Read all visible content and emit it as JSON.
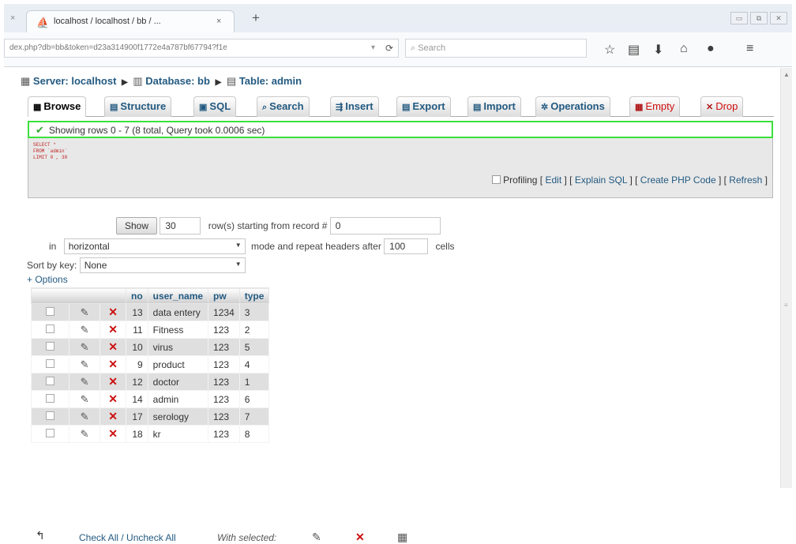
{
  "browser": {
    "tab_close_left": "×",
    "tab_title": "localhost / localhost / bb / ...",
    "tab_close": "×",
    "new_tab": "+",
    "url": "dex.php?db=bb&token=d23a314900f1772e4a787bf67794?f1e",
    "search_placeholder": "Search",
    "win_minimize": "▭",
    "win_restore": "⧉",
    "win_close": "✕"
  },
  "breadcrumb": {
    "server": "Server: localhost",
    "database": "Database: bb",
    "table": "Table: admin"
  },
  "tabs": [
    {
      "label": "Browse",
      "icon": "▦"
    },
    {
      "label": "Structure",
      "icon": "▤"
    },
    {
      "label": "SQL",
      "icon": "▣"
    },
    {
      "label": "Search",
      "icon": "⌕"
    },
    {
      "label": "Insert",
      "icon": "⇶"
    },
    {
      "label": "Export",
      "icon": "▤"
    },
    {
      "label": "Import",
      "icon": "▤"
    },
    {
      "label": "Operations",
      "icon": "✲"
    },
    {
      "label": "Empty",
      "icon": "▦"
    },
    {
      "label": "Drop",
      "icon": "✕"
    }
  ],
  "status": {
    "message": "Showing rows 0 - 7 (8 total, Query took 0.0006 sec)",
    "sql_query": "SELECT *\nFROM `admin`\nLIMIT 0 , 30"
  },
  "sql_links": {
    "profiling": "Profiling",
    "edit": "Edit",
    "explain": "Explain SQL",
    "create_php": "Create PHP Code",
    "refresh": "Refresh"
  },
  "nav_controls": {
    "show_button": "Show",
    "rows_value": "30",
    "rows_label": "row(s) starting from record #",
    "start_value": "0",
    "in_label": "in",
    "mode_value": "horizontal",
    "mode_label": "mode and repeat headers after",
    "repeat_value": "100",
    "cells_label": "cells",
    "sort_label": "Sort by key:",
    "sort_value": "None",
    "options_link": "+ Options"
  },
  "table": {
    "columns": [
      "no",
      "user_name",
      "pw",
      "type"
    ],
    "rows": [
      {
        "no": "13",
        "user_name": "data entery",
        "pw": "1234",
        "type": "3"
      },
      {
        "no": "11",
        "user_name": "Fitness",
        "pw": "123",
        "type": "2"
      },
      {
        "no": "10",
        "user_name": "virus",
        "pw": "123",
        "type": "5"
      },
      {
        "no": "9",
        "user_name": "product",
        "pw": "123",
        "type": "4"
      },
      {
        "no": "12",
        "user_name": "doctor",
        "pw": "123",
        "type": "1"
      },
      {
        "no": "14",
        "user_name": "admin",
        "pw": "123",
        "type": "6"
      },
      {
        "no": "17",
        "user_name": "serology",
        "pw": "123",
        "type": "7"
      },
      {
        "no": "18",
        "user_name": "kr",
        "pw": "123",
        "type": "8"
      }
    ]
  },
  "footer": {
    "check_all": "Check All / Uncheck All",
    "with_selected": "With selected:"
  }
}
